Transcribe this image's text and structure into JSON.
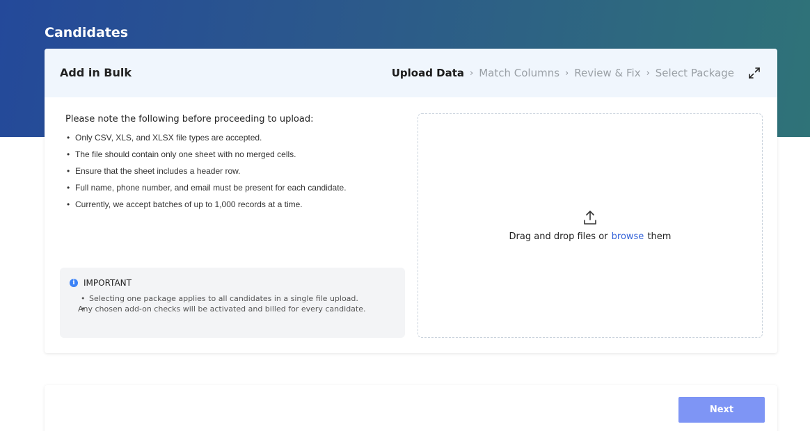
{
  "page": {
    "title": "Candidates"
  },
  "card": {
    "title": "Add in Bulk",
    "steps": [
      {
        "label": "Upload Data",
        "active": true
      },
      {
        "label": "Match Columns",
        "active": false
      },
      {
        "label": "Review & Fix",
        "active": false
      },
      {
        "label": "Select Package",
        "active": false
      }
    ],
    "step_separator": "›",
    "expand_icon": "expand-icon"
  },
  "notes": {
    "heading": "Please note the following before proceeding to upload:",
    "items": [
      "Only CSV, XLS, and XLSX file types are accepted.",
      "The file should contain only one sheet with no merged cells.",
      "Ensure that the sheet includes a header row.",
      "Full name, phone number, and email must be present for each candidate.",
      "Currently, we accept batches of up to 1,000 records at a time."
    ]
  },
  "important": {
    "icon": "info-icon",
    "icon_glyph": "i",
    "title": "IMPORTANT",
    "items": [
      "Selecting one package applies to all candidates in a single file upload.",
      "Any chosen add-on checks will be activated and billed for every candidate."
    ]
  },
  "dropzone": {
    "icon": "upload-icon",
    "text_before": "Drag and drop files or",
    "link": "browse",
    "text_after": "them"
  },
  "footer": {
    "next_label": "Next"
  },
  "colors": {
    "accent": "#3563d9",
    "next_button": "#7e95f5",
    "header_bg": "#f0f6fd",
    "info": "#3b82f6"
  }
}
